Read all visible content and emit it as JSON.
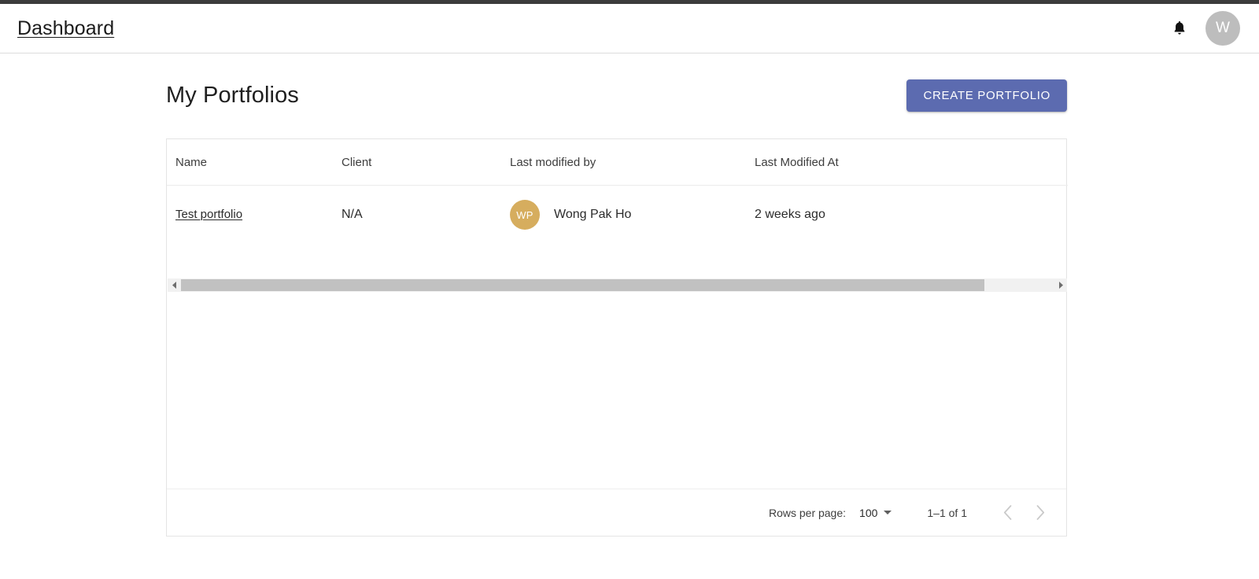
{
  "header": {
    "brand": "Dashboard",
    "notification_icon": "bell-icon",
    "avatar_initial": "W"
  },
  "main": {
    "title": "My Portfolios",
    "create_button": "CREATE PORTFOLIO"
  },
  "table": {
    "columns": [
      "Name",
      "Client",
      "Last modified by",
      "Last Modified At"
    ],
    "rows": [
      {
        "name": "Test portfolio",
        "client": "N/A",
        "modified_by_initials": "WP",
        "modified_by": "Wong Pak Ho",
        "modified_at": "2 weeks ago"
      }
    ]
  },
  "pagination": {
    "rows_per_page_label": "Rows per page:",
    "rows_per_page_value": "100",
    "range": "1–1 of 1",
    "prev_icon": "chevron-left-icon",
    "next_icon": "chevron-right-icon"
  },
  "colors": {
    "accent_button": "#5c6bb0",
    "user_avatar": "#d6ad5e",
    "header_avatar": "#bdbdbd"
  }
}
